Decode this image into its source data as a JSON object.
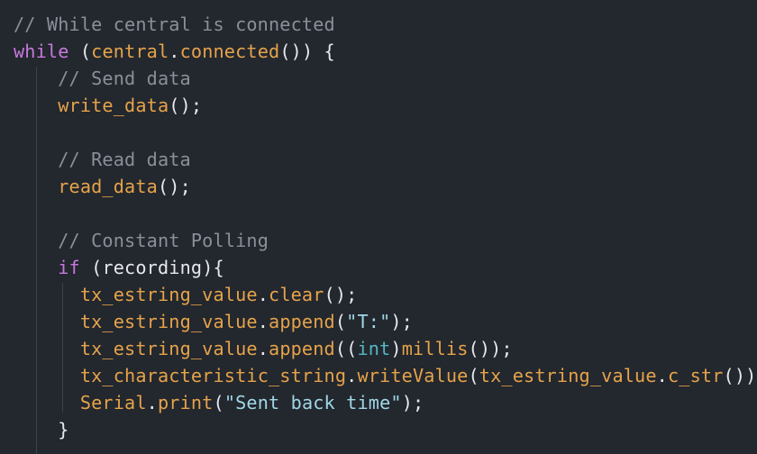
{
  "editor": {
    "theme_colors": {
      "background": "#23272e",
      "comment": "#8a9099",
      "keyword": "#c678dd",
      "identifier": "#e5a34a",
      "punctuation": "#e6e8ec",
      "string": "#9fd7e6",
      "type": "#56b6c2",
      "indent_guide": "#3b414b"
    },
    "lines": [
      {
        "tokens": [
          {
            "t": "// While central is connected",
            "k": "comment"
          }
        ]
      },
      {
        "tokens": [
          {
            "t": "while",
            "k": "keyword"
          },
          {
            "t": " (",
            "k": "punct"
          },
          {
            "t": "central",
            "k": "ident"
          },
          {
            "t": ".",
            "k": "punct"
          },
          {
            "t": "connected",
            "k": "func"
          },
          {
            "t": "()) {",
            "k": "punct"
          }
        ]
      },
      {
        "tokens": [
          {
            "t": "    ",
            "k": "punct"
          },
          {
            "t": "// Send data",
            "k": "comment"
          }
        ]
      },
      {
        "tokens": [
          {
            "t": "    ",
            "k": "punct"
          },
          {
            "t": "write_data",
            "k": "func"
          },
          {
            "t": "();",
            "k": "punct"
          }
        ]
      },
      {
        "tokens": []
      },
      {
        "tokens": [
          {
            "t": "    ",
            "k": "punct"
          },
          {
            "t": "// Read data",
            "k": "comment"
          }
        ]
      },
      {
        "tokens": [
          {
            "t": "    ",
            "k": "punct"
          },
          {
            "t": "read_data",
            "k": "func"
          },
          {
            "t": "();",
            "k": "punct"
          }
        ]
      },
      {
        "tokens": []
      },
      {
        "tokens": [
          {
            "t": "    ",
            "k": "punct"
          },
          {
            "t": "// Constant Polling",
            "k": "comment"
          }
        ]
      },
      {
        "tokens": [
          {
            "t": "    ",
            "k": "punct"
          },
          {
            "t": "if",
            "k": "keyword"
          },
          {
            "t": " (",
            "k": "punct"
          },
          {
            "t": "recording",
            "k": "punct"
          },
          {
            "t": "){",
            "k": "punct"
          }
        ]
      },
      {
        "tokens": [
          {
            "t": "      ",
            "k": "punct"
          },
          {
            "t": "tx_estring_value",
            "k": "ident"
          },
          {
            "t": ".",
            "k": "punct"
          },
          {
            "t": "clear",
            "k": "func"
          },
          {
            "t": "();",
            "k": "punct"
          }
        ]
      },
      {
        "tokens": [
          {
            "t": "      ",
            "k": "punct"
          },
          {
            "t": "tx_estring_value",
            "k": "ident"
          },
          {
            "t": ".",
            "k": "punct"
          },
          {
            "t": "append",
            "k": "func"
          },
          {
            "t": "(",
            "k": "punct"
          },
          {
            "t": "\"T:\"",
            "k": "string"
          },
          {
            "t": ");",
            "k": "punct"
          }
        ]
      },
      {
        "tokens": [
          {
            "t": "      ",
            "k": "punct"
          },
          {
            "t": "tx_estring_value",
            "k": "ident"
          },
          {
            "t": ".",
            "k": "punct"
          },
          {
            "t": "append",
            "k": "func"
          },
          {
            "t": "((",
            "k": "punct"
          },
          {
            "t": "int",
            "k": "type"
          },
          {
            "t": ")",
            "k": "punct"
          },
          {
            "t": "millis",
            "k": "func"
          },
          {
            "t": "());",
            "k": "punct"
          }
        ]
      },
      {
        "tokens": [
          {
            "t": "      ",
            "k": "punct"
          },
          {
            "t": "tx_characteristic_string",
            "k": "ident"
          },
          {
            "t": ".",
            "k": "punct"
          },
          {
            "t": "writeValue",
            "k": "func"
          },
          {
            "t": "(",
            "k": "punct"
          },
          {
            "t": "tx_estring_value",
            "k": "ident"
          },
          {
            "t": ".",
            "k": "punct"
          },
          {
            "t": "c_str",
            "k": "func"
          },
          {
            "t": "());",
            "k": "punct"
          }
        ]
      },
      {
        "tokens": [
          {
            "t": "      ",
            "k": "punct"
          },
          {
            "t": "Serial",
            "k": "ident"
          },
          {
            "t": ".",
            "k": "punct"
          },
          {
            "t": "print",
            "k": "func"
          },
          {
            "t": "(",
            "k": "punct"
          },
          {
            "t": "\"Sent back time\"",
            "k": "string"
          },
          {
            "t": ");",
            "k": "punct"
          }
        ]
      },
      {
        "tokens": [
          {
            "t": "    ",
            "k": "punct"
          },
          {
            "t": "}",
            "k": "punct"
          }
        ]
      },
      {
        "tokens": []
      }
    ]
  }
}
